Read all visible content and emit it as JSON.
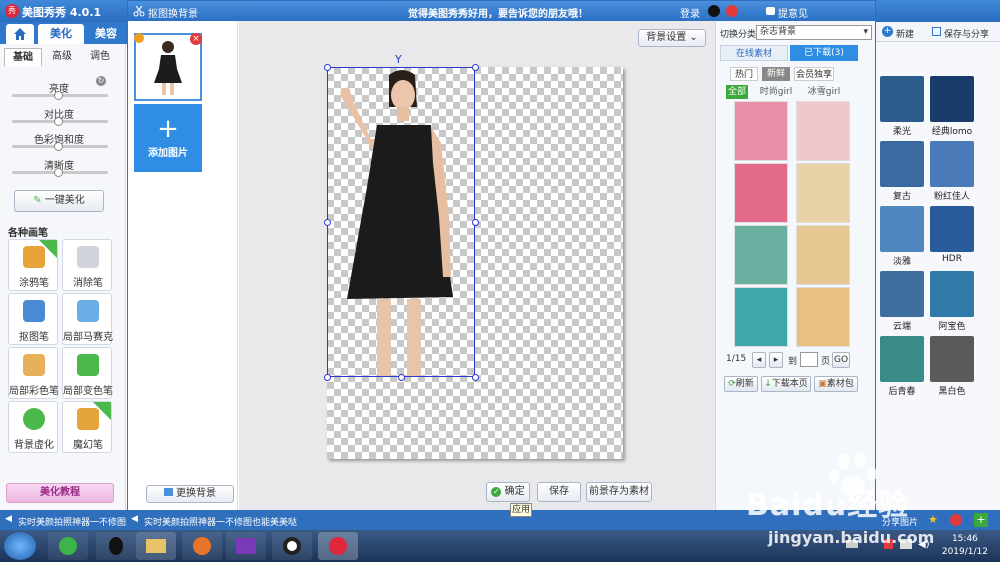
{
  "app": {
    "name": "美图秀秀 4.0.1",
    "logo": "秀"
  },
  "main_tabs": {
    "home_icon": "home-icon",
    "beautify": "美化",
    "beauty": "美容"
  },
  "left": {
    "subtabs": [
      "基础",
      "高级",
      "调色"
    ],
    "sliders": [
      {
        "label": "亮度",
        "value": 0.5
      },
      {
        "label": "对比度",
        "value": 0.5
      },
      {
        "label": "色彩饱和度",
        "value": 0.5
      },
      {
        "label": "清晰度",
        "value": 0.5
      }
    ],
    "one_click": "一键美化",
    "brushes_title": "各种画笔",
    "tools": [
      {
        "label": "涂鸦笔",
        "badge": "升级",
        "icon": "pencil-icon",
        "color": "#e8a23a"
      },
      {
        "label": "消除笔",
        "icon": "eraser-icon",
        "color": "#d0d4da"
      },
      {
        "label": "抠图笔",
        "icon": "cutout-pen-icon",
        "color": "#4a8ad4"
      },
      {
        "label": "局部马赛克",
        "icon": "mosaic-icon",
        "color": "#6aaee8"
      },
      {
        "label": "局部彩色笔",
        "icon": "color-brush-icon",
        "color": "#e8b05a"
      },
      {
        "label": "局部变色笔",
        "icon": "recolor-bucket-icon",
        "color": "#4ab84a"
      },
      {
        "label": "背景虚化",
        "icon": "blur-icon",
        "color": "#4ab84a"
      },
      {
        "label": "魔幻笔",
        "badge": "new",
        "icon": "magic-wand-icon",
        "color": "#e4a43a"
      }
    ],
    "tutorial": "美化教程"
  },
  "dialog": {
    "title": "抠图换背景",
    "slogan": "觉得美图秀秀好用，要告诉您的朋友哦！",
    "login": "登录",
    "tip": "提意见",
    "add_picture": "添加图片",
    "replace_bg": "更换背景",
    "bg_settings": "背景设置",
    "confirm": "确定",
    "confirm_tooltip": "应用",
    "save": "保存",
    "save_as_material": "前景存为素材"
  },
  "materials": {
    "switch_label": "切换分类",
    "category": "杂志背景",
    "tabs": [
      "在线素材",
      "已下载(3)"
    ],
    "filters": [
      "热门",
      "新鲜",
      "会员独享"
    ],
    "subfilters": [
      "全部",
      "时尚girl",
      "冰雪girl"
    ],
    "items": [
      {
        "name": "magazine-bg-1",
        "color": "#e98fa8"
      },
      {
        "name": "magazine-bg-2",
        "color": "#f0c8cc"
      },
      {
        "name": "magazine-bg-3",
        "color": "#e46a8a"
      },
      {
        "name": "magazine-bg-4",
        "color": "#e9d2a8"
      },
      {
        "name": "magazine-bg-5",
        "color": "#6ab0a0"
      },
      {
        "name": "magazine-bg-6",
        "color": "#e8c892"
      },
      {
        "name": "magazine-bg-7",
        "color": "#3ea8a8"
      },
      {
        "name": "magazine-bg-8",
        "color": "#e8c080"
      }
    ],
    "page": "1/15",
    "goto": "到",
    "page_unit": "页",
    "go": "GO",
    "refresh": "刷新",
    "download_page": "下载本页",
    "material_pack": "素材包"
  },
  "far_right": {
    "new_label": "新建",
    "save_share": "保存与分享",
    "effects": [
      {
        "label": "柔光",
        "color": "#2c5c8c"
      },
      {
        "label": "经典lomo",
        "color": "#1a3c6a"
      },
      {
        "label": "复古",
        "color": "#3a6aa0"
      },
      {
        "label": "粉红佳人",
        "color": "#4a7ab8"
      },
      {
        "label": "淡雅",
        "color": "#4f86c0"
      },
      {
        "label": "HDR",
        "color": "#285a9c"
      },
      {
        "label": "云端",
        "color": "#3d6e9e"
      },
      {
        "label": "阿宝色",
        "color": "#2f7aa8"
      },
      {
        "label": "后青春",
        "color": "#3a8a8a"
      },
      {
        "label": "黑白色",
        "color": "#5a5a5a"
      }
    ],
    "share_pic": "分享图片"
  },
  "status": {
    "left": "实时美颜拍照神器一不修图",
    "right": "实时美颜拍照神器一不修图也能美美哒"
  },
  "taskbar": {
    "time": "15:46",
    "date": "2019/1/12"
  },
  "watermark": {
    "text": "Baidu经验",
    "url": "jingyan.baidu.com"
  }
}
